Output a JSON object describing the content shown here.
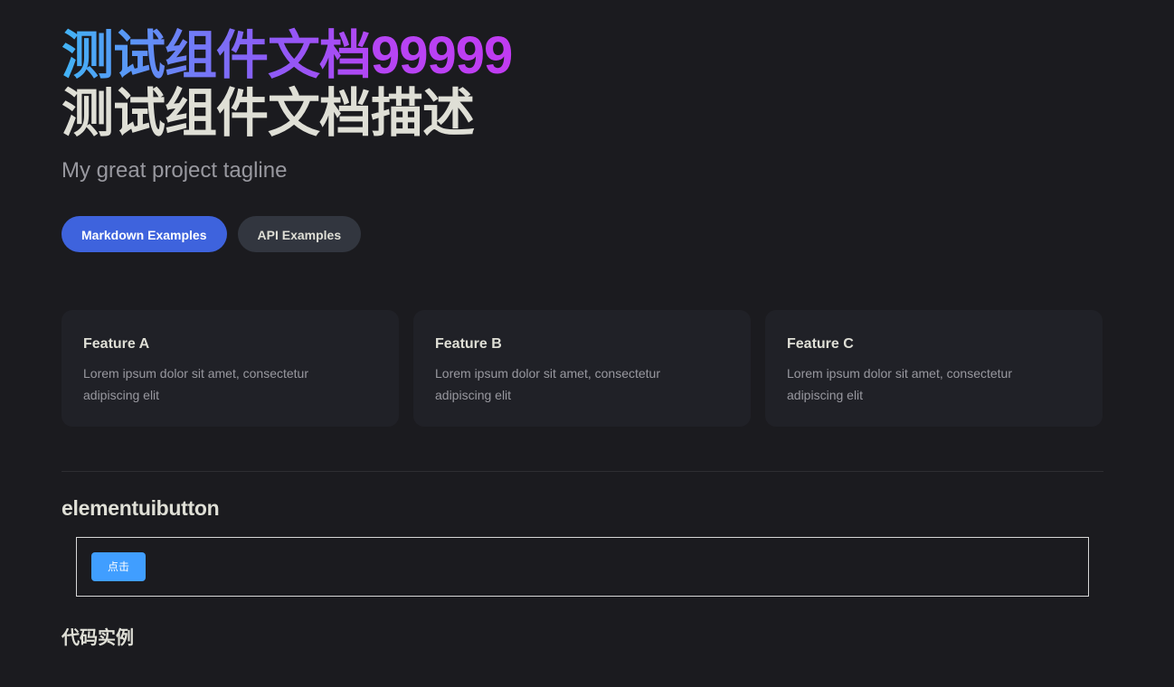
{
  "hero": {
    "name": "测试组件文档99999",
    "text": "测试组件文档描述",
    "tagline": "My great project tagline"
  },
  "actions": {
    "primary_label": "Markdown Examples",
    "secondary_label": "API Examples"
  },
  "features": [
    {
      "title": "Feature A",
      "details": "Lorem ipsum dolor sit amet, consectetur adipiscing elit"
    },
    {
      "title": "Feature B",
      "details": "Lorem ipsum dolor sit amet, consectetur adipiscing elit"
    },
    {
      "title": "Feature C",
      "details": "Lorem ipsum dolor sit amet, consectetur adipiscing elit"
    }
  ],
  "section": {
    "title": "elementuibutton",
    "demo_button_label": "点击",
    "code_title": "代码实例"
  },
  "colors": {
    "background": "#1b1b1f",
    "brand": "#3e63dd",
    "element_primary": "#409eff",
    "gradient_start": "#41b4f6",
    "gradient_end": "#c13bf2"
  }
}
